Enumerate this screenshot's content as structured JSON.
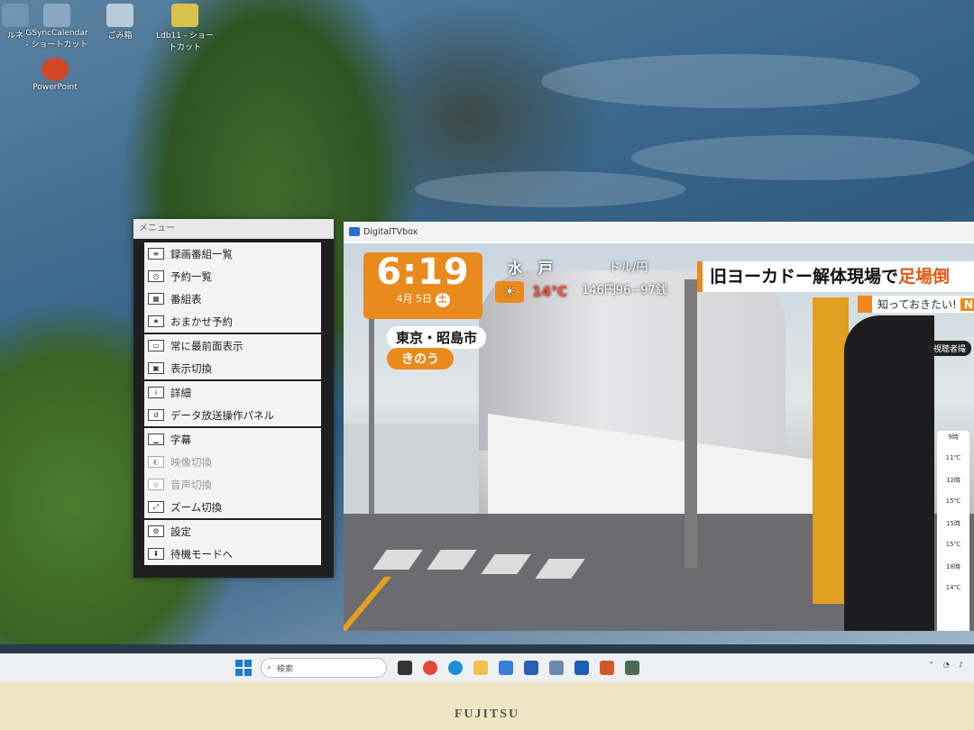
{
  "desktop": {
    "icons": [
      {
        "label": "ルネ",
        "icon": "shortcut-icon"
      },
      {
        "label": "GSyncCalendar - ショートカット",
        "icon": "calendar-icon"
      },
      {
        "label": "ごみ箱",
        "icon": "recycle-bin-icon"
      },
      {
        "label": "Ldb11 - ショートカット",
        "icon": "app-icon"
      },
      {
        "label": "PowerPoint",
        "icon": "powerpoint-icon"
      }
    ]
  },
  "menu": {
    "title": "メニュー",
    "items": [
      {
        "label": "録画番組一覧",
        "icon": "recorded-list-icon",
        "enabled": true
      },
      {
        "label": "予約一覧",
        "icon": "reservation-list-icon",
        "enabled": true
      },
      {
        "label": "番組表",
        "icon": "program-guide-icon",
        "enabled": true
      },
      {
        "label": "おまかせ予約",
        "icon": "auto-reserve-icon",
        "enabled": true
      },
      {
        "label": "常に最前面表示",
        "icon": "always-on-top-icon",
        "enabled": true
      },
      {
        "label": "表示切換",
        "icon": "display-switch-icon",
        "enabled": true
      },
      {
        "label": "詳細",
        "icon": "info-icon",
        "enabled": true
      },
      {
        "label": "データ放送操作パネル",
        "icon": "data-broadcast-icon",
        "enabled": true
      },
      {
        "label": "字幕",
        "icon": "subtitles-icon",
        "enabled": true
      },
      {
        "label": "映像切換",
        "icon": "video-switch-icon",
        "enabled": false
      },
      {
        "label": "音声切換",
        "icon": "audio-switch-icon",
        "enabled": false
      },
      {
        "label": "ズーム切換",
        "icon": "zoom-icon",
        "enabled": true
      },
      {
        "label": "設定",
        "icon": "gear-icon",
        "enabled": true
      },
      {
        "label": "待機モードへ",
        "icon": "standby-icon",
        "enabled": true
      }
    ]
  },
  "tv": {
    "window_title": "DigitalTVbox",
    "overlay": {
      "time": "6:19",
      "month_label": "4月",
      "day_label": "5日",
      "weekday": "土",
      "weather_city": "水戸",
      "weather_temp": "14℃",
      "fx_label": "ドル/円",
      "fx_rate": "146円96−97銭",
      "location": "東京・昭島市",
      "tag": "きのう",
      "headline_prefix": "旧ヨーカドー解体現場で",
      "headline_highlight": "足場倒",
      "subhead": "知っておきたい!",
      "subhead_badge": "NEW",
      "viewers_label": "視聴者撮",
      "side_items": [
        "9時",
        "11℃",
        "12時",
        "15℃",
        "15時",
        "15℃",
        "18時",
        "14℃"
      ]
    }
  },
  "taskbar": {
    "search_placeholder": "検索",
    "apps": [
      "file-explorer-icon",
      "chrome-icon",
      "edge-icon",
      "folder-icon",
      "mail-icon",
      "calendar-icon",
      "pen-icon",
      "tv-icon",
      "app-icon",
      "store-icon"
    ]
  },
  "monitor": {
    "brand": "FUJITSU"
  }
}
